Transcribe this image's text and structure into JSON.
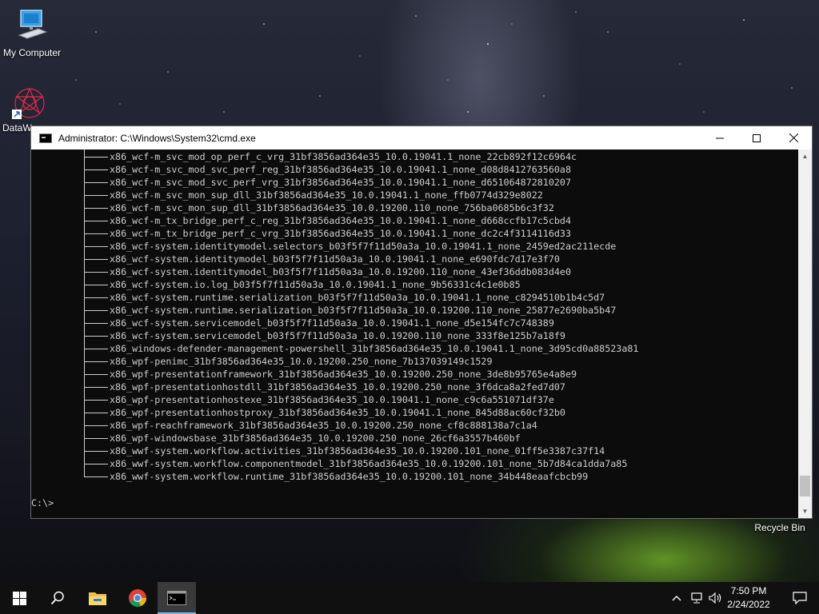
{
  "desktop": {
    "icons": [
      {
        "label": "My Computer"
      },
      {
        "label": "DataW"
      },
      {
        "label": "Recycle Bin"
      }
    ]
  },
  "window": {
    "title": "Administrator: C:\\Windows\\System32\\cmd.exe",
    "controls": {
      "minimize": "—",
      "maximize": "☐",
      "close": "✕"
    }
  },
  "console": {
    "lines": [
      "x86_wcf-m_svc_mod_op_perf_c_vrg_31bf3856ad364e35_10.0.19041.1_none_22cb892f12c6964c",
      "x86_wcf-m_svc_mod_svc_perf_reg_31bf3856ad364e35_10.0.19041.1_none_d08d8412763560a8",
      "x86_wcf-m_svc_mod_svc_perf_vrg_31bf3856ad364e35_10.0.19041.1_none_d651064872810207",
      "x86_wcf-m_svc_mon_sup_dll_31bf3856ad364e35_10.0.19041.1_none_ffb0774d329e8022",
      "x86_wcf-m_svc_mon_sup_dll_31bf3856ad364e35_10.0.19200.110_none_756ba0685b6c3f32",
      "x86_wcf-m_tx_bridge_perf_c_reg_31bf3856ad364e35_10.0.19041.1_none_d668ccfb17c5cbd4",
      "x86_wcf-m_tx_bridge_perf_c_vrg_31bf3856ad364e35_10.0.19041.1_none_dc2c4f3114116d33",
      "x86_wcf-system.identitymodel.selectors_b03f5f7f11d50a3a_10.0.19041.1_none_2459ed2ac211ecde",
      "x86_wcf-system.identitymodel_b03f5f7f11d50a3a_10.0.19041.1_none_e690fdc7d17e3f70",
      "x86_wcf-system.identitymodel_b03f5f7f11d50a3a_10.0.19200.110_none_43ef36ddb083d4e0",
      "x86_wcf-system.io.log_b03f5f7f11d50a3a_10.0.19041.1_none_9b56331c4c1e0b85",
      "x86_wcf-system.runtime.serialization_b03f5f7f11d50a3a_10.0.19041.1_none_c8294510b1b4c5d7",
      "x86_wcf-system.runtime.serialization_b03f5f7f11d50a3a_10.0.19200.110_none_25877e2690ba5b47",
      "x86_wcf-system.servicemodel_b03f5f7f11d50a3a_10.0.19041.1_none_d5e154fc7c748389",
      "x86_wcf-system.servicemodel_b03f5f7f11d50a3a_10.0.19200.110_none_333f8e125b7a18f9",
      "x86_windows-defender-management-powershell_31bf3856ad364e35_10.0.19041.1_none_3d95cd0a88523a81",
      "x86_wpf-penimc_31bf3856ad364e35_10.0.19200.250_none_7b137039149c1529",
      "x86_wpf-presentationframework_31bf3856ad364e35_10.0.19200.250_none_3de8b95765e4a8e9",
      "x86_wpf-presentationhostdll_31bf3856ad364e35_10.0.19200.250_none_3f6dca8a2fed7d07",
      "x86_wpf-presentationhostexe_31bf3856ad364e35_10.0.19041.1_none_c9c6a551071df37e",
      "x86_wpf-presentationhostproxy_31bf3856ad364e35_10.0.19041.1_none_845d88ac60cf32b0",
      "x86_wpf-reachframework_31bf3856ad364e35_10.0.19200.250_none_cf8c888138a7c1a4",
      "x86_wpf-windowsbase_31bf3856ad364e35_10.0.19200.250_none_26cf6a3557b460bf",
      "x86_wwf-system.workflow.activities_31bf3856ad364e35_10.0.19200.101_none_01ff5e3387c37f14",
      "x86_wwf-system.workflow.componentmodel_31bf3856ad364e35_10.0.19200.101_none_5b7d84ca1dda7a85",
      "x86_wwf-system.workflow.runtime_31bf3856ad364e35_10.0.19200.101_none_34b448eaafcbcb99"
    ],
    "prompt": "C:\\>"
  },
  "taskbar": {
    "time": "7:50 PM",
    "date": "2/24/2022",
    "icons": [
      "windows-start-icon",
      "search-icon",
      "file-explorer-icon",
      "chrome-icon",
      "cmd-icon"
    ],
    "tray_icons": [
      "chevron-up-icon",
      "network-icon",
      "volume-icon",
      "notification-icon"
    ]
  }
}
